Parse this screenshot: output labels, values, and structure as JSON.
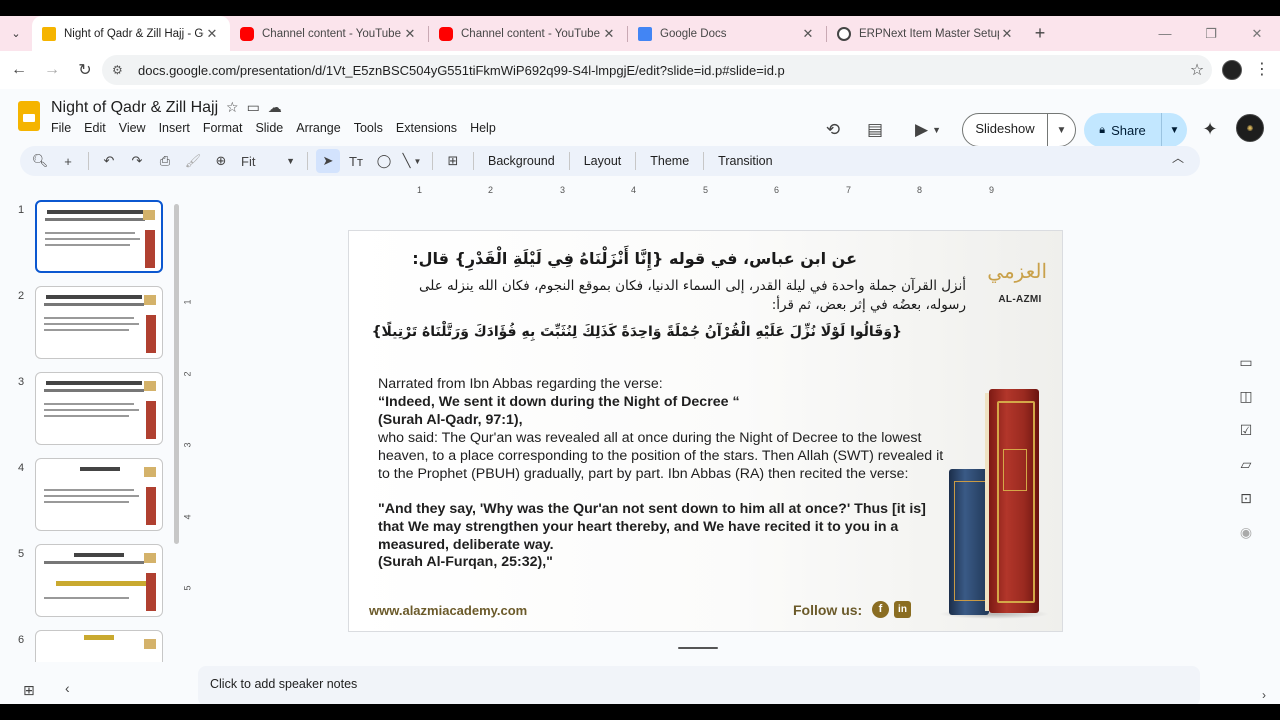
{
  "browser": {
    "tabs": [
      {
        "title": "Night of Qadr & Zill Hajj - Goo",
        "favicon_color": "#f5b400",
        "active": true
      },
      {
        "title": "Channel content - YouTube Stu",
        "favicon_color": "#ff0000",
        "active": false
      },
      {
        "title": "Channel content - YouTube Stu",
        "favicon_color": "#ff0000",
        "active": false
      },
      {
        "title": "Google Docs",
        "favicon_color": "#4285f4",
        "active": false
      },
      {
        "title": "ERPNext Item Master Setup",
        "favicon_color": "#444444",
        "active": false
      }
    ],
    "url": "docs.google.com/presentation/d/1Vt_E5znBSC504yG551tiFkmWiP692q99-S4l-lmpgjE/edit?slide=id.p#slide=id.p"
  },
  "doc": {
    "title": "Night of Qadr & Zill Hajj",
    "menu": [
      "File",
      "Edit",
      "View",
      "Insert",
      "Format",
      "Slide",
      "Arrange",
      "Tools",
      "Extensions",
      "Help"
    ],
    "slideshow_label": "Slideshow",
    "share_label": "Share"
  },
  "toolbar": {
    "zoom": "Fit",
    "background": "Background",
    "layout": "Layout",
    "theme": "Theme",
    "transition": "Transition"
  },
  "ruler": {
    "h": [
      "1",
      "2",
      "3",
      "4",
      "5",
      "6",
      "7",
      "8",
      "9"
    ],
    "v": [
      "1",
      "2",
      "3",
      "4",
      "5"
    ]
  },
  "filmstrip": {
    "slides": [
      "1",
      "2",
      "3",
      "4",
      "5",
      "6"
    ],
    "active": 1
  },
  "slide": {
    "arabic_title": "عن ابن عباس، في قوله {إِنَّا أَنْزَلْنَاهُ فِي لَيْلَةِ الْقَدْرِ} قال:",
    "arabic_body": "أنزل القرآن جملة واحدة في ليلة القدر، إلى السماء الدنيا، فكان بموقع النجوم، فكان الله ينزله على رسوله، بعضُه في إثر بعض، ثم قرأ:",
    "arabic_verse": "{وَقَالُوا لَوْلَا نُزِّلَ عَلَيْهِ الْقُرْآنُ جُمْلَةً وَاحِدَةً كَذَلِكَ لِنُثَبِّتَ بِهِ فُؤَادَكَ وَرَتَّلْنَاهُ تَرْتِيلًا}",
    "en_line1": "Narrated from Ibn Abbas regarding the verse:",
    "en_line2": "“Indeed, We sent it down during the Night of Decree “",
    "en_line3": "(Surah Al-Qadr, 97:1),",
    "en_para": "who said: The Qur'an was revealed all at once during the Night of Decree to the lowest heaven, to a place corresponding to the position of the stars. Then Allah (SWT) revealed it to the Prophet (PBUH) gradually, part by part. Ibn Abbas (RA) then recited the verse:",
    "en_quote": "\"And they say, 'Why was the Qur'an not sent down to him all at once?' Thus [it is] that We may strengthen your heart thereby, and We have recited it to you in a measured, deliberate way.",
    "en_ref": "(Surah Al-Furqan, 25:32),\"",
    "website": "www.alazmiacademy.com",
    "follow": "Follow us:",
    "logo_ar": "العزمي",
    "logo_en": "AL-AZMI"
  },
  "notes_placeholder": "Click to add speaker notes"
}
